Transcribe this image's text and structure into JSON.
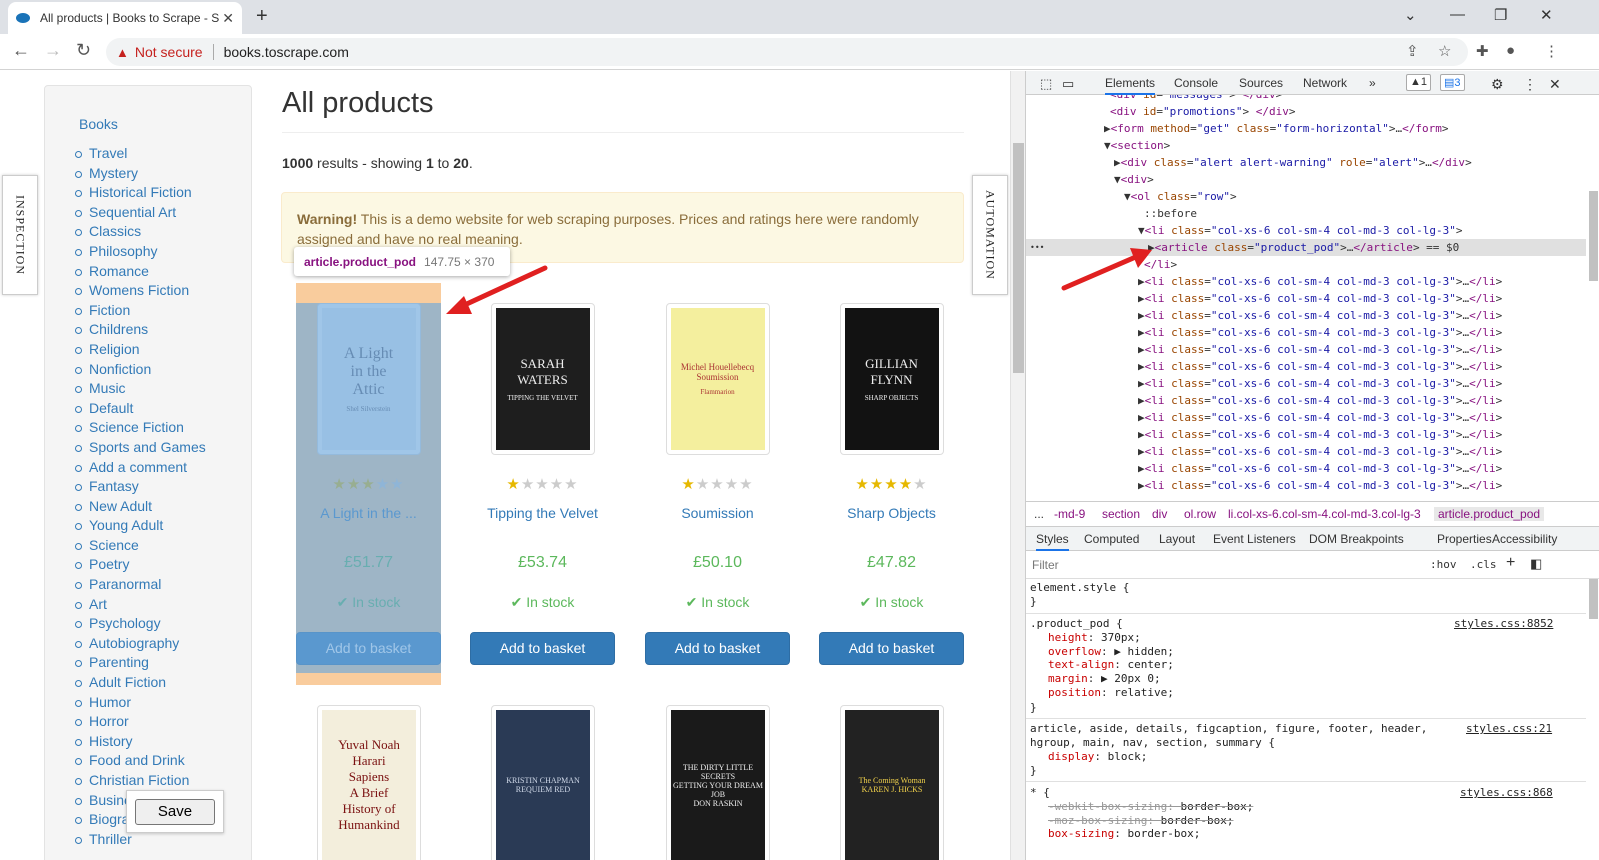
{
  "browser": {
    "tab_title": "All products | Books to Scrape - S",
    "security_label": "Not secure",
    "url": "books.toscrape.com"
  },
  "sidebar": {
    "heading": "Books",
    "categories": [
      "Travel",
      "Mystery",
      "Historical Fiction",
      "Sequential Art",
      "Classics",
      "Philosophy",
      "Romance",
      "Womens Fiction",
      "Fiction",
      "Childrens",
      "Religion",
      "Nonfiction",
      "Music",
      "Default",
      "Science Fiction",
      "Sports and Games",
      "Add a comment",
      "Fantasy",
      "New Adult",
      "Young Adult",
      "Science",
      "Poetry",
      "Paranormal",
      "Art",
      "Psychology",
      "Autobiography",
      "Parenting",
      "Adult Fiction",
      "Humor",
      "Horror",
      "History",
      "Food and Drink",
      "Christian Fiction",
      "Business",
      "Biography",
      "Thriller"
    ]
  },
  "main": {
    "title": "All products",
    "results": {
      "count": "1000",
      "text1": " results - showing ",
      "from": "1",
      "text2": " to ",
      "to": "20",
      "text3": "."
    },
    "alert": {
      "strong": "Warning!",
      "text": " This is a demo website for web scraping purposes. Prices and ratings here were randomly assigned and have no real meaning."
    },
    "products": [
      {
        "title": "A Light in the ...",
        "price": "£51.77",
        "rating": 3,
        "stock": "In stock",
        "button": "Add to basket",
        "cover_lines": [
          "A Light",
          "in the",
          "Attic"
        ],
        "cover_sub": "Shel Silverstein"
      },
      {
        "title": "Tipping the Velvet",
        "price": "£53.74",
        "rating": 1,
        "stock": "In stock",
        "button": "Add to basket",
        "cover_lines": [
          "SARAH",
          "WATERS"
        ],
        "cover_sub": "TIPPING THE VELVET"
      },
      {
        "title": "Soumission",
        "price": "£50.10",
        "rating": 1,
        "stock": "In stock",
        "button": "Add to basket",
        "cover_lines": [
          "Michel Houellebecq",
          "Soumission"
        ],
        "cover_sub": "Flammarion"
      },
      {
        "title": "Sharp Objects",
        "price": "£47.82",
        "rating": 4,
        "stock": "In stock",
        "button": "Add to basket",
        "cover_lines": [
          "GILLIAN",
          "FLYNN"
        ],
        "cover_sub": "SHARP OBJECTS"
      }
    ],
    "row2_covers": [
      {
        "lines": [
          "Yuval Noah",
          "Harari",
          "Sapiens",
          "A Brief",
          "History of",
          "Humankind"
        ]
      },
      {
        "lines": [
          "KRISTIN CHAPMAN",
          "REQUIEM RED"
        ]
      },
      {
        "lines": [
          "THE DIRTY LITTLE SECRETS",
          "GETTING YOUR DREAM JOB",
          "DON RASKIN"
        ]
      },
      {
        "lines": [
          "The Coming Woman",
          "KAREN J. HICKS"
        ]
      }
    ]
  },
  "inspector_tooltip": {
    "name": "article.product_pod",
    "dims": "147.75 × 370"
  },
  "save_button": "Save",
  "side_tabs": {
    "left": "INSPECTION",
    "right": "AUTOMATION"
  },
  "devtools": {
    "tabs": [
      "Elements",
      "Console",
      "Sources",
      "Network",
      "»"
    ],
    "warn_count": "1",
    "msg_count": "3",
    "dom_lines": [
      "<div id=\"messages\"> </div>",
      "<div id=\"promotions\"> </div>",
      "▶<form method=\"get\" class=\"form-horizontal\">…</form>",
      "▼<section>",
      "▶<div class=\"alert alert-warning\" role=\"alert\">…</div>",
      "▼<div>",
      "▼<ol class=\"row\">",
      "::before",
      "▼<li class=\"col-xs-6 col-sm-4 col-md-3 col-lg-3\">",
      "▶<article class=\"product_pod\">…</article> == $0",
      "</li>",
      "▶<li class=\"col-xs-6 col-sm-4 col-md-3 col-lg-3\">…</li>",
      "▶<li class=\"col-xs-6 col-sm-4 col-md-3 col-lg-3\">…</li>",
      "▶<li class=\"col-xs-6 col-sm-4 col-md-3 col-lg-3\">…</li>",
      "▶<li class=\"col-xs-6 col-sm-4 col-md-3 col-lg-3\">…</li>",
      "▶<li class=\"col-xs-6 col-sm-4 col-md-3 col-lg-3\">…</li>",
      "▶<li class=\"col-xs-6 col-sm-4 col-md-3 col-lg-3\">…</li>",
      "▶<li class=\"col-xs-6 col-sm-4 col-md-3 col-lg-3\">…</li>",
      "▶<li class=\"col-xs-6 col-sm-4 col-md-3 col-lg-3\">…</li>",
      "▶<li class=\"col-xs-6 col-sm-4 col-md-3 col-lg-3\">…</li>",
      "▶<li class=\"col-xs-6 col-sm-4 col-md-3 col-lg-3\">…</li>",
      "▶<li class=\"col-xs-6 col-sm-4 col-md-3 col-lg-3\">…</li>",
      "▶<li class=\"col-xs-6 col-sm-4 col-md-3 col-lg-3\">…</li>",
      "▶<li class=\"col-xs-6 col-sm-4 col-md-3 col-lg-3\">…</li>"
    ],
    "breadcrumbs": [
      "...",
      "-md-9",
      "section",
      "div",
      "ol.row",
      "li.col-xs-6.col-sm-4.col-md-3.col-lg-3",
      "article.product_pod"
    ],
    "panel_tabs": [
      "Styles",
      "Computed",
      "Layout",
      "Event Listeners",
      "DOM Breakpoints",
      "Properties",
      "Accessibility"
    ],
    "filter_placeholder": "Filter",
    "filter_hov": ":hov",
    "filter_cls": ".cls",
    "styles": {
      "element_style": "element.style {",
      "close": "}",
      "pod_selector": ".product_pod {",
      "pod_link": "styles.css:8852",
      "pod_props": [
        {
          "p": "height",
          "v": "370px;"
        },
        {
          "p": "overflow",
          "v": "▶ hidden;"
        },
        {
          "p": "text-align",
          "v": "center;"
        },
        {
          "p": "margin",
          "v": "▶ 20px 0;"
        },
        {
          "p": "position",
          "v": "relative;"
        }
      ],
      "article_selector": "article, aside, details, figcaption, figure, footer, header,",
      "article_selector2": "hgroup, main, nav, section, summary {",
      "article_link": "styles.css:21",
      "article_prop": {
        "p": "display",
        "v": "block;"
      },
      "star_selector": "* {",
      "star_link": "styles.css:868",
      "star_props": [
        {
          "p": "-webkit-box-sizing",
          "v": "border-box;",
          "struck": true
        },
        {
          "p": "-moz-box-sizing",
          "v": "border-box;",
          "struck": true
        },
        {
          "p": "box-sizing",
          "v": "border-box;",
          "struck": false
        }
      ]
    }
  },
  "colors": {
    "link": "#337ab7",
    "price": "#5cb85c",
    "button": "#337ab7",
    "highlight": "#6fa8dc",
    "margin_highlight": "#f9cc9d",
    "arrow": "#e02020"
  }
}
